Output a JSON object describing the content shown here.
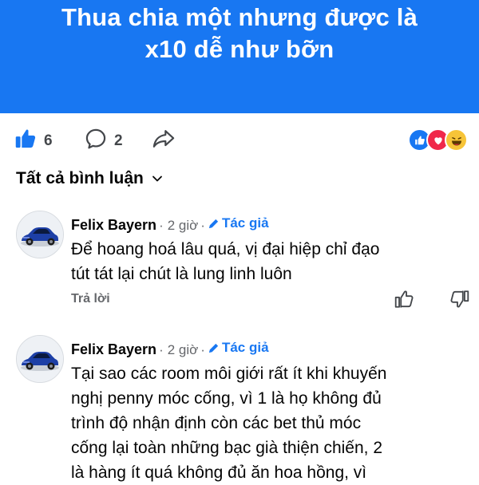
{
  "post": {
    "banner_lines": [
      "Thua chia một nhưng được là",
      "x10 dễ như bỡn"
    ]
  },
  "actions": {
    "like_count": "6",
    "comment_count": "2",
    "reactions": [
      "like-icon",
      "love-icon",
      "haha-icon"
    ]
  },
  "comments_section": {
    "sort_label": "Tất cả bình luận"
  },
  "comments": [
    {
      "author": "Felix Bayern",
      "time": "2 giờ",
      "sep": "·",
      "author_tag": "Tác giả",
      "lines": [
        "Để hoang hoá lâu quá, vị đại hiệp chỉ đạo",
        "tút tát lại chút là lung linh luôn"
      ],
      "reply_label": "Trả lời"
    },
    {
      "author": "Felix Bayern",
      "time": "2 giờ",
      "sep": "·",
      "author_tag": "Tác giả",
      "lines": [
        "Tại sao các room môi giới rất ít khi khuyến",
        "nghị penny móc cống, vì 1 là họ không đủ",
        "trình độ nhận định còn các bet thủ móc",
        "cống lại toàn những bạc già thiện chiến, 2",
        "là hàng ít quá không đủ ăn hoa hồng, vì"
      ]
    }
  ],
  "colors": {
    "brand_blue": "#1877f2",
    "muted_text": "#65676b",
    "love_red": "#f0284a",
    "haha_yellow": "#f7c438"
  }
}
